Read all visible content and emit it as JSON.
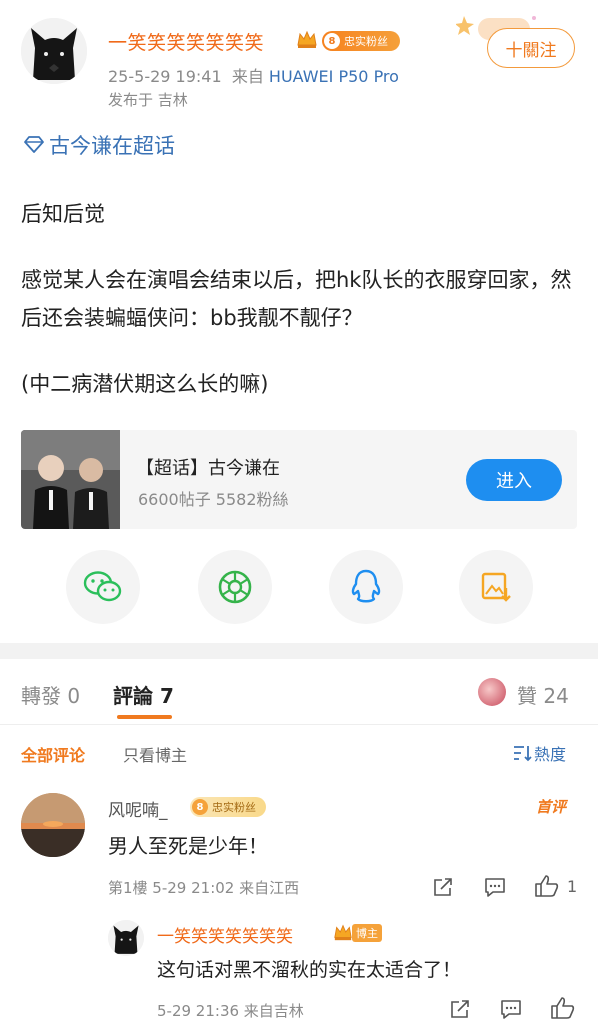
{
  "post": {
    "author": "一笑笑笑笑笑笑笑",
    "fan_badge": "忠实粉丝",
    "fan_level": "8",
    "time": "25-5-29 19:41",
    "source_prefix": "来自",
    "device": "HUAWEI P50 Pro",
    "location": "发布于 吉林",
    "follow_label": "十關注",
    "topic_tag": "古今谦在超话",
    "paragraphs": [
      "后知后觉",
      "感觉某人会在演唱会结束以后，把hk队长的衣服穿回家，然后还会装蝙蝠侠问：bb我靓不靓仔？",
      "(中二病潜伏期这么长的嘛)"
    ]
  },
  "topic_card": {
    "title": "【超话】古今谦在",
    "stats": "6600帖子 5582粉絲",
    "enter_label": "进入"
  },
  "share": {
    "icons": [
      "wechat-icon",
      "moments-icon",
      "qq-icon",
      "save-image-icon"
    ],
    "colors": {
      "wechat": "#2bbf5b",
      "moments": "#35b34a",
      "qq": "#1e8ef0",
      "save": "#f5a623"
    }
  },
  "tabs": {
    "repost": "轉發 0",
    "comments": "評論 7",
    "likes": "贊 24"
  },
  "filters": {
    "all": "全部评论",
    "owner_only": "只看博主",
    "sort": "熱度"
  },
  "comment": {
    "author": "风呢喃_",
    "fan_badge": "忠实粉丝",
    "fan_level": "8",
    "first_badge": "首评",
    "text": "男人至死是少年！",
    "meta": "第1樓  5-29 21:02  来自江西",
    "like_count": "1"
  },
  "reply": {
    "author": "一笑笑笑笑笑笑笑",
    "owner_badge": "博主",
    "text": "这句话对黑不溜秋的实在太适合了！",
    "meta": "5-29 21:36  来自吉林"
  },
  "theme": {
    "accent": "#f07a1f",
    "link": "#3a72b5",
    "primary_button": "#1e8ef0"
  }
}
